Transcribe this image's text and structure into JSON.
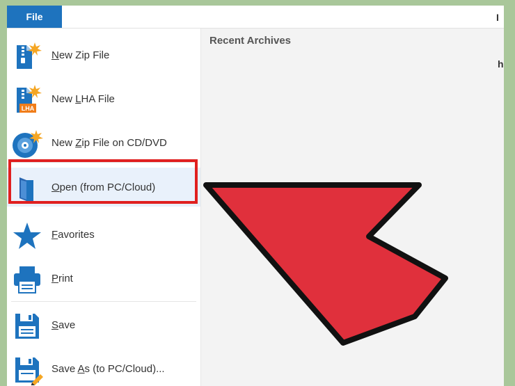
{
  "ribbon": {
    "file_tab": "File",
    "right_glyph_top": "I",
    "right_glyph_mid": "h"
  },
  "menu": {
    "items": [
      {
        "pre": "",
        "mnemonic": "N",
        "post": "ew Zip File",
        "icon": "new-zip-file-icon"
      },
      {
        "pre": "New ",
        "mnemonic": "L",
        "post": "HA File",
        "icon": "new-lha-file-icon"
      },
      {
        "pre": "New ",
        "mnemonic": "Z",
        "post": "ip File on CD/DVD",
        "icon": "new-zip-cd-dvd-icon"
      },
      {
        "pre": "",
        "mnemonic": "O",
        "post": "pen (from PC/Cloud)",
        "icon": "open-folder-icon"
      },
      {
        "pre": "",
        "mnemonic": "F",
        "post": "avorites",
        "icon": "star-icon"
      },
      {
        "pre": "",
        "mnemonic": "P",
        "post": "rint",
        "icon": "printer-icon"
      },
      {
        "pre": "",
        "mnemonic": "S",
        "post": "ave",
        "icon": "floppy-save-icon"
      },
      {
        "pre": "Save ",
        "mnemonic": "A",
        "post": "s (to PC/Cloud)...",
        "icon": "floppy-save-as-icon"
      }
    ],
    "lha_badge": "LHA"
  },
  "recent": {
    "title": "Recent Archives"
  },
  "colors": {
    "accent": "#1e73be",
    "highlight_border": "#e02020",
    "arrow_fill": "#e0303c",
    "frame_bg": "#a9c79a"
  }
}
